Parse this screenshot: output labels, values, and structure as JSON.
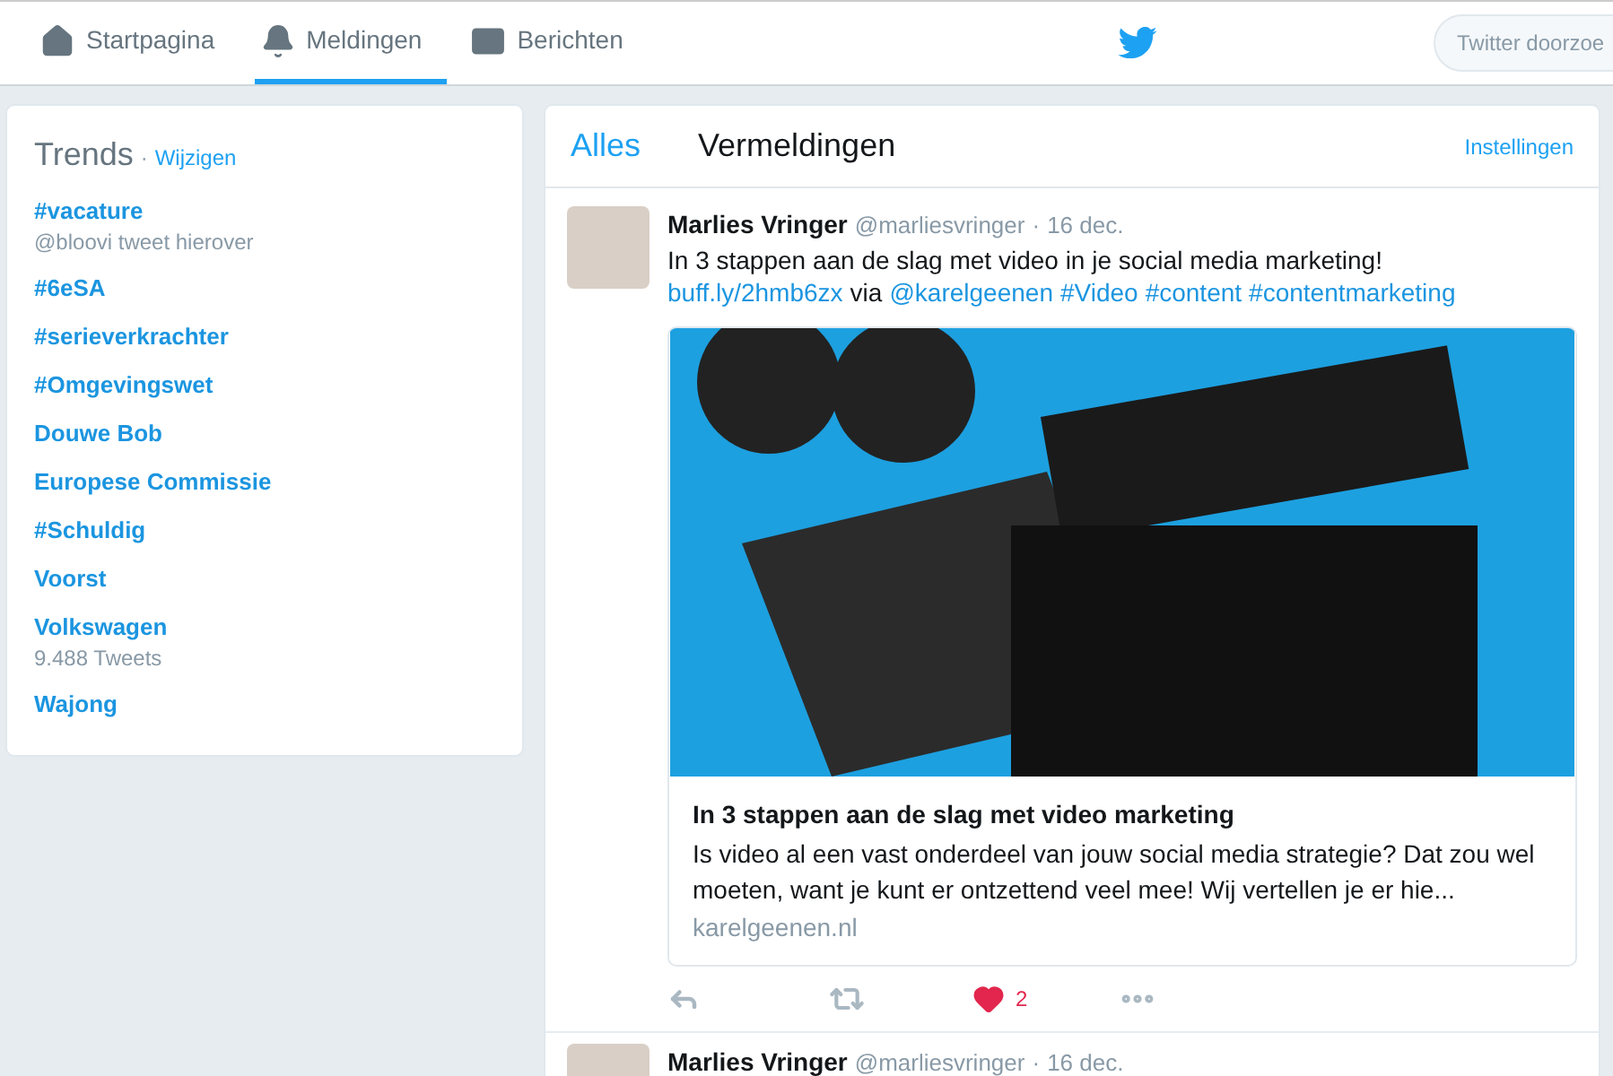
{
  "nav": {
    "items": [
      {
        "label": "Startpagina",
        "kind": "home",
        "selected": false
      },
      {
        "label": "Meldingen",
        "kind": "bell",
        "selected": true
      },
      {
        "label": "Berichten",
        "kind": "mail",
        "selected": false
      }
    ],
    "search": {
      "placeholder": "Twitter doorzoe"
    }
  },
  "trends": {
    "title": "Trends",
    "separator": "·",
    "change_link": "Wijzigen",
    "items": [
      {
        "name": "#vacature",
        "meta": "@bloovi tweet hierover"
      },
      {
        "name": "#6eSA"
      },
      {
        "name": "#serieverkrachter"
      },
      {
        "name": "#Omgevingswet"
      },
      {
        "name": "Douwe Bob"
      },
      {
        "name": "Europese Commissie"
      },
      {
        "name": "#Schuldig"
      },
      {
        "name": "Voorst"
      },
      {
        "name": "Volkswagen",
        "meta": "9.488 Tweets"
      },
      {
        "name": "Wajong"
      }
    ]
  },
  "feed": {
    "tabs": [
      {
        "label": "Alles",
        "selected": true
      },
      {
        "label": "Vermeldingen",
        "selected": false
      }
    ],
    "settings_link": "Instellingen",
    "tweets": [
      {
        "name": "Marlies Vringer",
        "handle": "@marliesvringer",
        "dot": "·",
        "date": "16 dec.",
        "text": "In 3 stappen aan de slag met video in je social media marketing!",
        "link": "buff.ly/2hmb6zx",
        "via": "via",
        "mention": "@karelgeenen",
        "hashtags": [
          "#Video",
          "#content",
          "#contentmarketing"
        ],
        "card": {
          "title": "In 3 stappen aan de slag met video marketing",
          "description": "Is video al een vast onderdeel van jouw social media strategie? Dat zou wel moeten, want je kunt er ontzettend veel mee! Wij vertellen je er hie...",
          "domain": "karelgeenen.nl"
        },
        "likes": "2",
        "liked": true
      },
      {
        "name": "Marlies Vringer",
        "handle": "@marliesvringer",
        "dot": "·",
        "date": "16 dec."
      }
    ]
  }
}
